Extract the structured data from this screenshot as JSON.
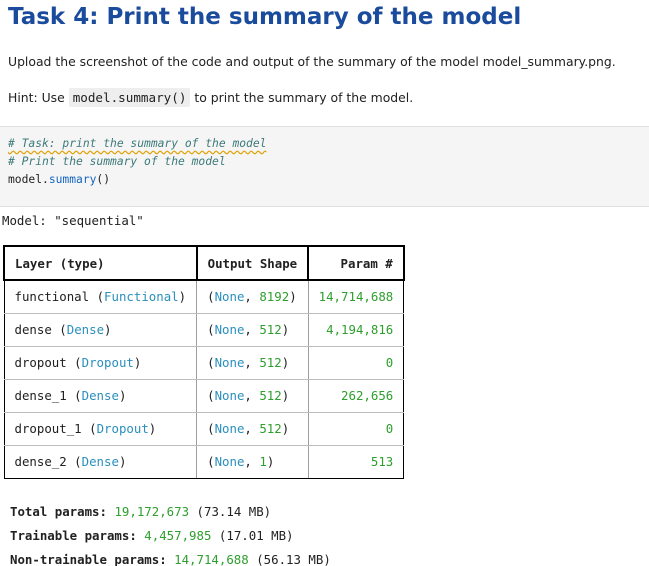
{
  "title": "Task 4: Print the summary of the model",
  "instruction": "Upload the screenshot of the code and output of the summary of the model model_summary.png.",
  "hint": {
    "prefix": "Hint: Use",
    "code": "model.summary()",
    "suffix": "to print the summary of the model."
  },
  "code_cell": {
    "line1": "# Task: print the summary of the model",
    "line2": "# Print the summary of the model",
    "line3_obj": "model.",
    "line3_fn": "summary",
    "line3_tail": "()"
  },
  "output": {
    "model_label": "Model: \"sequential\"",
    "headers": [
      "Layer (type)",
      "Output Shape",
      "Param #"
    ],
    "rows": [
      {
        "name": "functional",
        "type": "Functional",
        "shape_none": "None",
        "shape_dim": "8192",
        "params": "14,714,688"
      },
      {
        "name": "dense",
        "type": "Dense",
        "shape_none": "None",
        "shape_dim": "512",
        "params": "4,194,816"
      },
      {
        "name": "dropout",
        "type": "Dropout",
        "shape_none": "None",
        "shape_dim": "512",
        "params": "0"
      },
      {
        "name": "dense_1",
        "type": "Dense",
        "shape_none": "None",
        "shape_dim": "512",
        "params": "262,656"
      },
      {
        "name": "dropout_1",
        "type": "Dropout",
        "shape_none": "None",
        "shape_dim": "512",
        "params": "0"
      },
      {
        "name": "dense_2",
        "type": "Dense",
        "shape_none": "None",
        "shape_dim": "1",
        "params": "513"
      }
    ],
    "totals": [
      {
        "label": "Total params:",
        "value": "19,172,673",
        "size": "(73.14 MB)"
      },
      {
        "label": "Trainable params:",
        "value": "4,457,985",
        "size": "(17.01 MB)"
      },
      {
        "label": "Non-trainable params:",
        "value": "14,714,688",
        "size": "(56.13 MB)"
      }
    ]
  }
}
